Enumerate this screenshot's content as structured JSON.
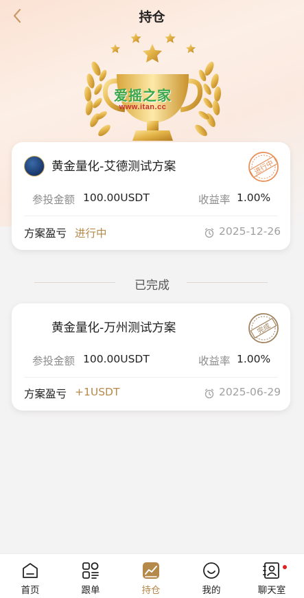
{
  "header": {
    "title": "持仓"
  },
  "watermark": {
    "cn": "爱摇之家",
    "url": "www.itan.cc"
  },
  "active_plans": [
    {
      "name": "黄金量化-艾德测试方案",
      "stamp_text": "进行中",
      "amount_label": "参投金额",
      "amount": "100.00USDT",
      "yield_label": "收益率",
      "yield": "1.00%",
      "pnl_label": "方案盈亏",
      "pnl_value": "进行中",
      "date": "2025-12-26"
    }
  ],
  "completed_section": {
    "title": "已完成"
  },
  "completed_plans": [
    {
      "name": "黄金量化-万州测试方案",
      "stamp_text": "完成",
      "amount_label": "参投金额",
      "amount": "100.00USDT",
      "yield_label": "收益率",
      "yield": "1.00%",
      "pnl_label": "方案盈亏",
      "pnl_value": "+1USDT",
      "date": "2025-06-29"
    }
  ],
  "tabbar": {
    "items": [
      {
        "label": "首页",
        "icon": "home-icon"
      },
      {
        "label": "跟单",
        "icon": "grid-icon"
      },
      {
        "label": "持仓",
        "icon": "chart-icon",
        "active": true
      },
      {
        "label": "我的",
        "icon": "smile-icon"
      },
      {
        "label": "聊天室",
        "icon": "contact-icon",
        "badge": true
      }
    ]
  },
  "colors": {
    "accent": "#b5894a",
    "stamp_active": "#e8905a",
    "stamp_done": "#a0825e",
    "badge": "#e02020"
  }
}
